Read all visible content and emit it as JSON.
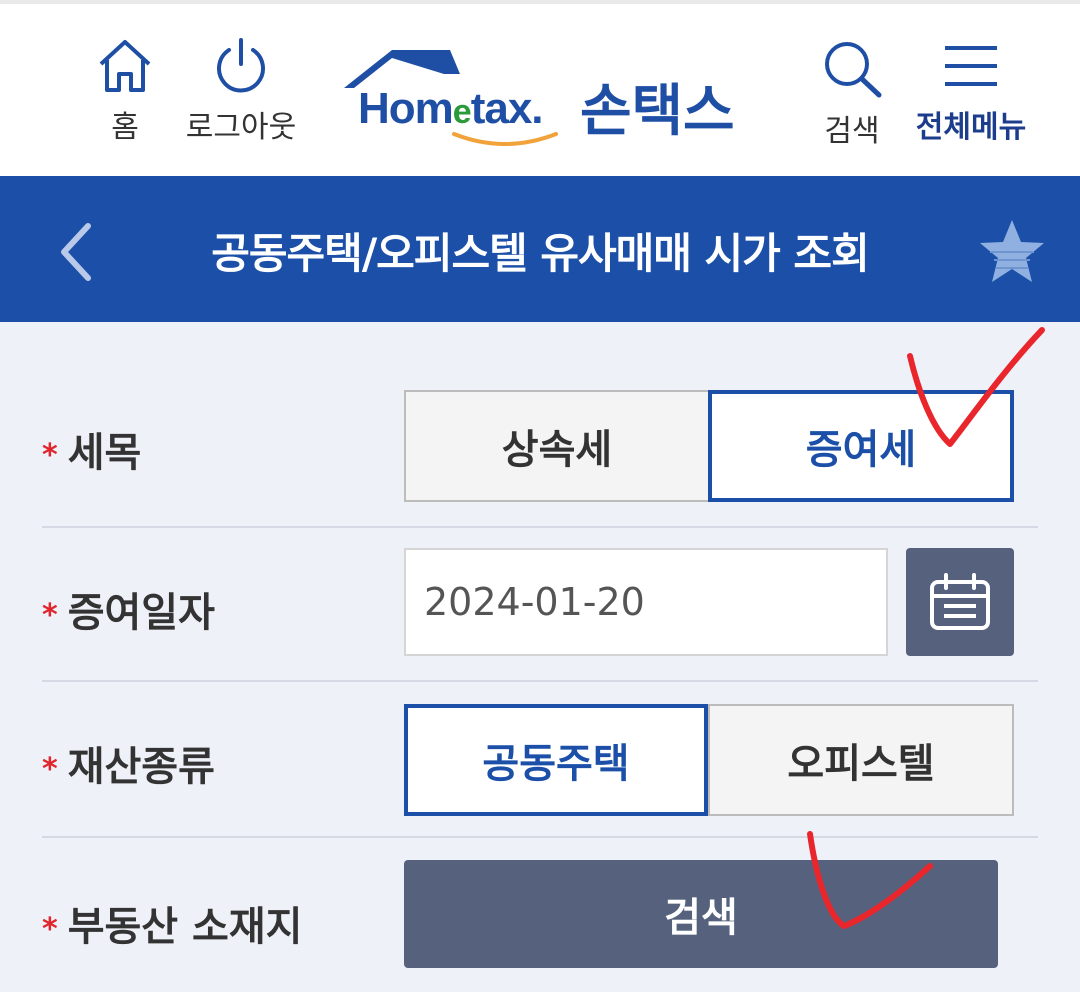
{
  "header": {
    "home_label": "홈",
    "logout_label": "로그아웃",
    "logo_en": "Hom",
    "logo_e": "e",
    "logo_en_rest": "tax.",
    "logo_ko": "손택스",
    "search_label": "검색",
    "menu_label": "전체메뉴"
  },
  "titlebar": {
    "title": "공동주택/오피스텔 유사매매 시가 조회"
  },
  "form": {
    "required_mark": "*",
    "tax_type": {
      "label": "세목",
      "options": [
        "상속세",
        "증여세"
      ],
      "selected": "증여세"
    },
    "gift_date": {
      "label": "증여일자",
      "value": "2024-01-20"
    },
    "property_type": {
      "label": "재산종류",
      "options": [
        "공동주택",
        "오피스텔"
      ],
      "selected": "공동주택"
    },
    "location": {
      "label": "부동산 소재지",
      "button_label": "검색"
    }
  },
  "colors": {
    "primary": "#1b4fa8",
    "button_dark": "#56627d",
    "required": "#e0262c",
    "annotation": "#e8262c"
  }
}
